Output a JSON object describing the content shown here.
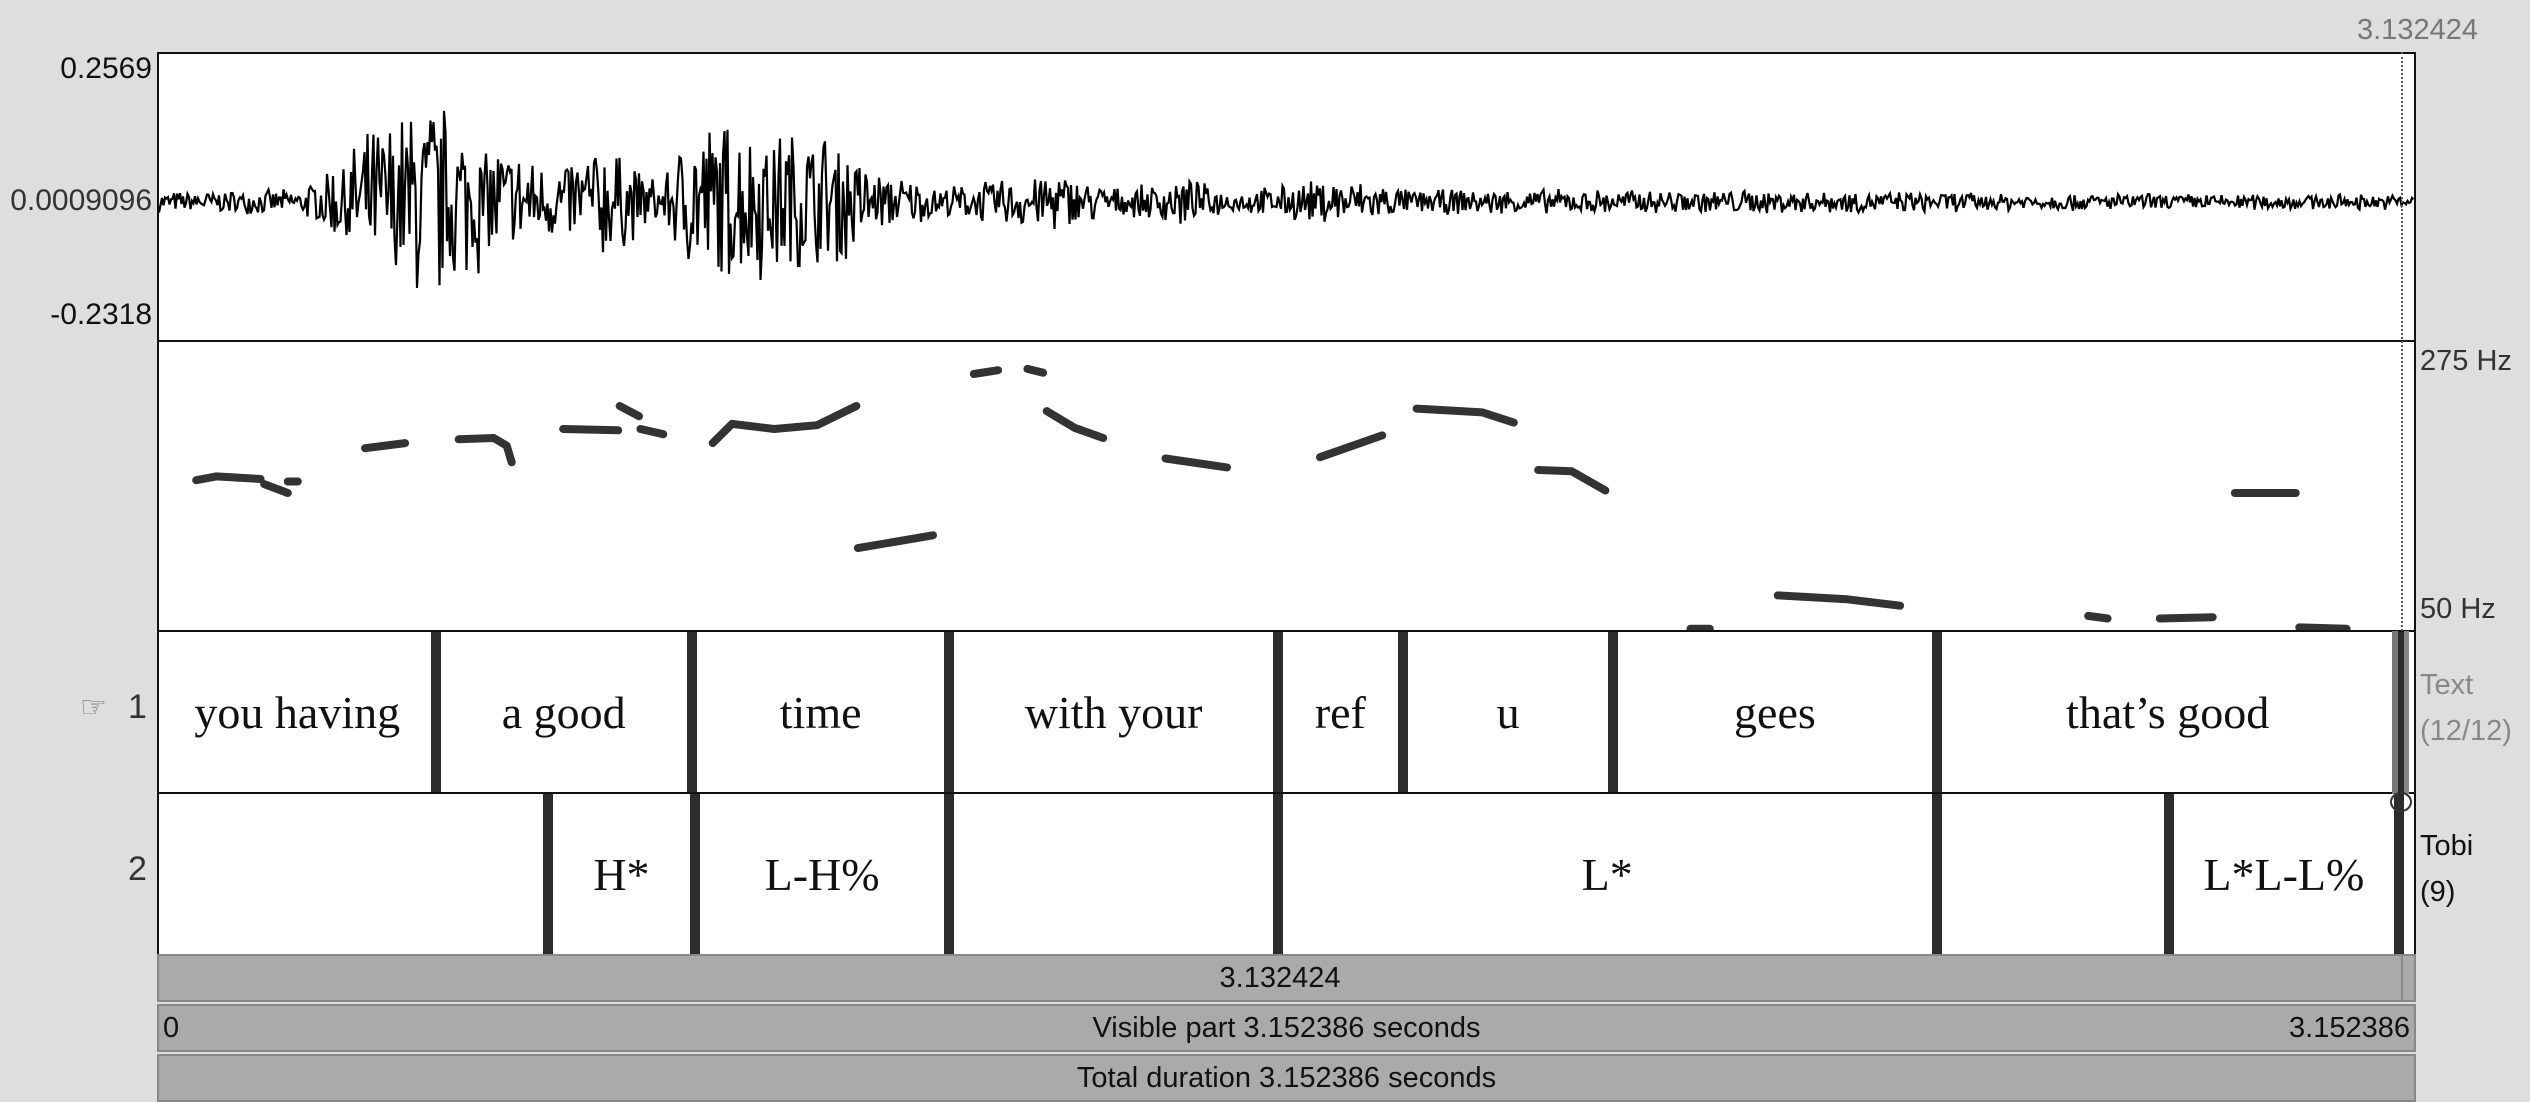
{
  "cursor_time": "3.132424",
  "waveform": {
    "max_label": "0.2569",
    "zero_label": "0.0009096",
    "min_label": "-0.2318"
  },
  "pitch": {
    "top_label": "275 Hz",
    "bottom_label": "50 Hz",
    "min_hz": 50,
    "max_hz": 275,
    "color": "#333333",
    "segments": [
      [
        [
          0.052,
          167
        ],
        [
          0.08,
          170
        ],
        [
          0.142,
          168
        ]
      ],
      [
        [
          0.147,
          164
        ],
        [
          0.18,
          157
        ]
      ],
      [
        [
          0.18,
          166
        ],
        [
          0.194,
          166
        ]
      ],
      [
        [
          0.288,
          192
        ],
        [
          0.344,
          196
        ]
      ],
      [
        [
          0.419,
          199
        ],
        [
          0.468,
          200
        ],
        [
          0.486,
          194
        ],
        [
          0.493,
          181
        ]
      ],
      [
        [
          0.565,
          207
        ],
        [
          0.642,
          206
        ]
      ],
      [
        [
          0.644,
          225
        ],
        [
          0.671,
          217
        ]
      ],
      [
        [
          0.673,
          207
        ],
        [
          0.705,
          203
        ]
      ],
      [
        [
          0.774,
          196
        ],
        [
          0.801,
          211
        ],
        [
          0.86,
          207
        ],
        [
          0.92,
          210
        ],
        [
          0.975,
          225
        ]
      ],
      [
        [
          0.977,
          114
        ],
        [
          1.082,
          124
        ]
      ],
      [
        [
          1.139,
          250
        ],
        [
          1.173,
          253
        ]
      ],
      [
        [
          1.214,
          254
        ],
        [
          1.236,
          251
        ]
      ],
      [
        [
          1.241,
          221
        ],
        [
          1.28,
          208
        ],
        [
          1.32,
          200
        ]
      ],
      [
        [
          1.407,
          184
        ],
        [
          1.493,
          177
        ]
      ],
      [
        [
          1.623,
          185
        ],
        [
          1.71,
          202
        ]
      ],
      [
        [
          1.758,
          223
        ],
        [
          1.85,
          220
        ],
        [
          1.894,
          212
        ]
      ],
      [
        [
          1.928,
          175
        ],
        [
          1.975,
          174
        ],
        [
          2.022,
          159
        ]
      ],
      [
        [
          2.141,
          51
        ],
        [
          2.168,
          51
        ]
      ],
      [
        [
          2.263,
          77
        ],
        [
          2.36,
          74
        ],
        [
          2.434,
          69
        ]
      ],
      [
        [
          2.697,
          61
        ],
        [
          2.724,
          59
        ]
      ],
      [
        [
          2.797,
          59
        ],
        [
          2.871,
          60
        ]
      ],
      [
        [
          2.902,
          157
        ],
        [
          2.987,
          157
        ]
      ],
      [
        [
          2.992,
          52
        ],
        [
          3.058,
          51
        ]
      ]
    ]
  },
  "duration": 3.152386,
  "tiers": [
    {
      "number": "1",
      "pointer": "☞",
      "name": "Text",
      "count": "(12/12)",
      "intervals": [
        {
          "start": 0,
          "end": 0.3866,
          "text": "you having"
        },
        {
          "start": 0.3866,
          "end": 0.745,
          "text": "a good"
        },
        {
          "start": 0.745,
          "end": 1.105,
          "text": "time"
        },
        {
          "start": 1.105,
          "end": 1.564,
          "text": "with your"
        },
        {
          "start": 1.564,
          "end": 1.739,
          "text": "ref"
        },
        {
          "start": 1.739,
          "end": 2.033,
          "text": "u"
        },
        {
          "start": 2.033,
          "end": 2.485,
          "text": "gees"
        },
        {
          "start": 2.485,
          "end": 3.131,
          "text": "that’s good"
        },
        {
          "start": 3.131,
          "end": 3.152386,
          "text": ""
        }
      ]
    },
    {
      "number": "2",
      "pointer": "",
      "name": "Tobi",
      "count": "(9)",
      "intervals": [
        {
          "start": 0,
          "end": 0.544,
          "text": ""
        },
        {
          "start": 0.544,
          "end": 0.749,
          "text": "H*"
        },
        {
          "start": 0.749,
          "end": 1.105,
          "text": "L-H%"
        },
        {
          "start": 1.105,
          "end": 1.564,
          "text": ""
        },
        {
          "start": 1.564,
          "end": 2.485,
          "text": "L*"
        },
        {
          "start": 2.485,
          "end": 2.81,
          "text": ""
        },
        {
          "start": 2.81,
          "end": 3.131,
          "text": "L*L-L%"
        },
        {
          "start": 3.131,
          "end": 3.152386,
          "text": ""
        }
      ]
    }
  ],
  "bars": {
    "cursor_bar": "3.132424",
    "visible_start": "0",
    "visible_label": "Visible part 3.152386 seconds",
    "visible_end": "3.152386",
    "total_label": "Total duration 3.152386 seconds"
  }
}
